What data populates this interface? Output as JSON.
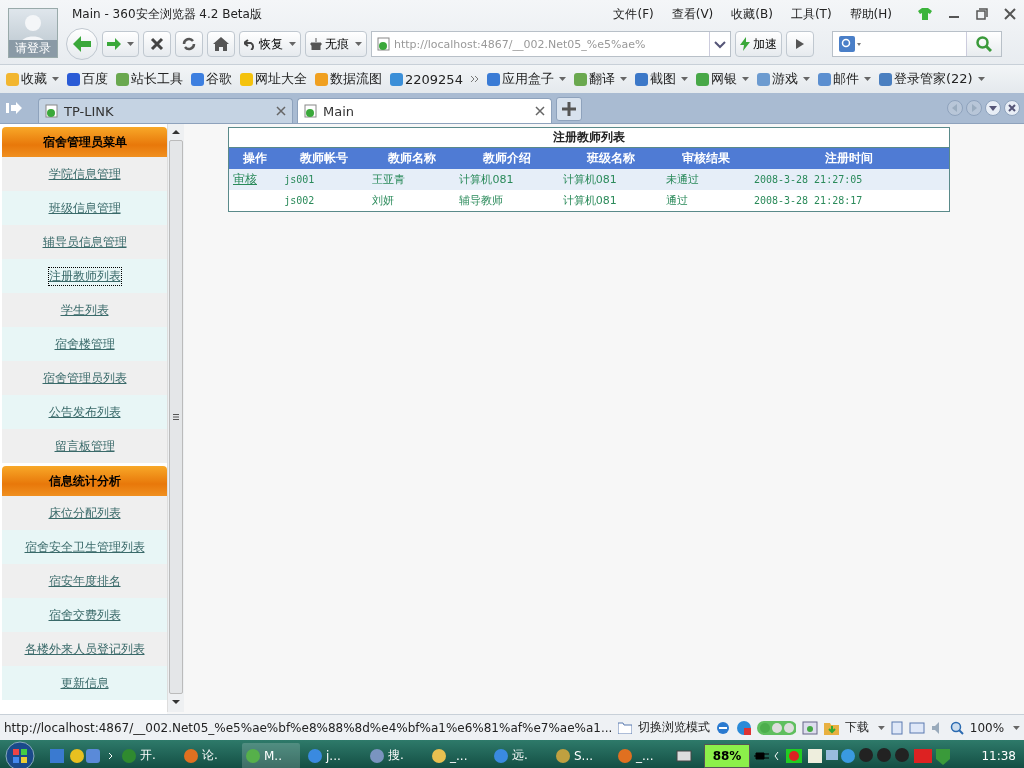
{
  "window": {
    "title": "Main - 360安全浏览器 4.2 Beta版",
    "login": "请登录",
    "menus": [
      "文件(F)",
      "查看(V)",
      "收藏(B)",
      "工具(T)",
      "帮助(H)"
    ]
  },
  "toolbar": {
    "buttons": [
      "恢复",
      "无痕"
    ],
    "address": "http://localhost:4867/__002.Net05_%e5%ae%",
    "speedup": "加速"
  },
  "bookmarks": [
    {
      "label": "收藏",
      "dropdown": true
    },
    {
      "label": "百度",
      "dropdown": false
    },
    {
      "label": "站长工具",
      "dropdown": false
    },
    {
      "label": "谷歌",
      "dropdown": false
    },
    {
      "label": "网址大全",
      "dropdown": false
    },
    {
      "label": "数据流图",
      "dropdown": false
    },
    {
      "label": "2209254",
      "dropdown": false
    },
    {
      "label": "应用盒子",
      "dropdown": true
    },
    {
      "label": "翻译",
      "dropdown": true
    },
    {
      "label": "截图",
      "dropdown": true
    },
    {
      "label": "网银",
      "dropdown": true
    },
    {
      "label": "游戏",
      "dropdown": true
    },
    {
      "label": "邮件",
      "dropdown": true
    },
    {
      "label": "登录管家(22)",
      "dropdown": true
    }
  ],
  "tabs": [
    {
      "label": "TP-LINK",
      "selected": false
    },
    {
      "label": "Main",
      "selected": true
    }
  ],
  "sidebar": {
    "sections": [
      {
        "title": "宿舍管理员菜单",
        "items": [
          {
            "label": "学院信息管理",
            "focused": false
          },
          {
            "label": "班级信息管理",
            "focused": false
          },
          {
            "label": "辅导员信息管理",
            "focused": false
          },
          {
            "label": "注册教师列表",
            "focused": true
          },
          {
            "label": "学生列表",
            "focused": false
          },
          {
            "label": "宿舍楼管理",
            "focused": false
          },
          {
            "label": "宿舍管理员列表",
            "focused": false
          },
          {
            "label": "公告发布列表",
            "focused": false
          },
          {
            "label": "留言板管理",
            "focused": false
          }
        ]
      },
      {
        "title": "信息统计分析",
        "items": [
          {
            "label": "床位分配列表",
            "focused": false
          },
          {
            "label": "宿舍安全卫生管理列表",
            "focused": false
          },
          {
            "label": "宿安年度排名",
            "focused": false
          },
          {
            "label": "宿舍交费列表",
            "focused": false
          },
          {
            "label": "各楼外来人员登记列表",
            "focused": false
          },
          {
            "label": "更新信息",
            "focused": false
          }
        ]
      }
    ]
  },
  "table": {
    "title": "注册教师列表",
    "columns": [
      "操作",
      "教师帐号",
      "教师名称",
      "教师介绍",
      "班级名称",
      "审核结果",
      "注册时间"
    ],
    "rows": [
      {
        "cells": [
          "审核",
          "js001",
          "王亚青",
          "计算机081",
          "计算机081",
          "未通过",
          "2008-3-28 21:27:05"
        ]
      },
      {
        "cells": [
          "",
          "js002",
          "刘妍",
          "辅导教师",
          "计算机081",
          "通过",
          "2008-3-28 21:28:17"
        ]
      }
    ]
  },
  "status_bar": {
    "url": "http://localhost:4867/__002.Net05_%e5%ae%bf%e8%88%8d%e4%bf%a1%e6%81%af%e7%ae%a1...",
    "mode": "切换浏览模式",
    "download": "下载",
    "zoom": "100%"
  },
  "taskbar": {
    "items": [
      {
        "label": "开.",
        "selected": false
      },
      {
        "label": "论.",
        "selected": false
      },
      {
        "label": "M..",
        "selected": true
      },
      {
        "label": "j...",
        "selected": false
      },
      {
        "label": "搜.",
        "selected": false
      },
      {
        "label": "_...",
        "selected": false
      },
      {
        "label": "远.",
        "selected": false
      },
      {
        "label": "S...",
        "selected": false
      },
      {
        "label": "_...",
        "selected": false
      }
    ],
    "battery": "88%",
    "clock": "11:38"
  }
}
